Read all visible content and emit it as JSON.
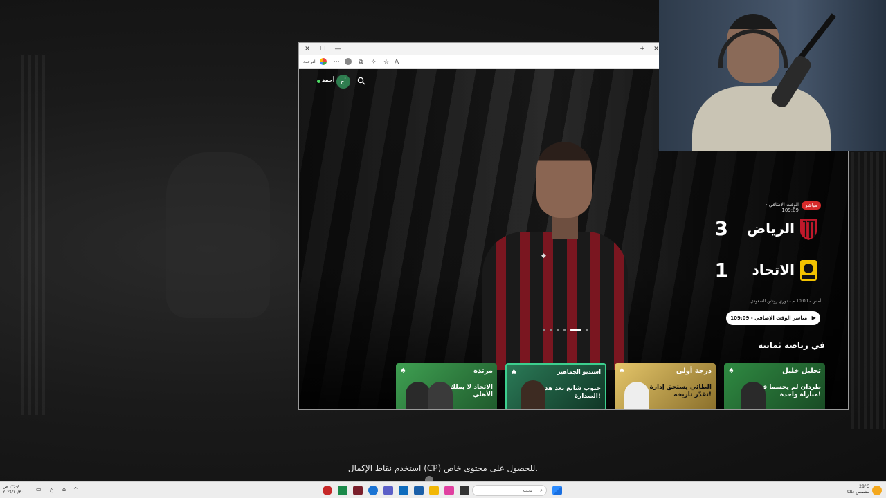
{
  "subtitle": "استخدم نقاط الإكمال (CP) للحصول على محتوى خاص.",
  "browser": {
    "titlebar": {
      "close": "✕",
      "maximize": "☐",
      "minimize": "—",
      "new_tab": "+"
    },
    "toolbar": {
      "label": "الترجمة",
      "more": "⋯",
      "read_aloud": "A"
    }
  },
  "site": {
    "user_name": "أحمد",
    "avatar_initials": "أح",
    "icons": {
      "search": "search-icon",
      "avatar": "avatar-icon"
    }
  },
  "match": {
    "live_label": "مباشر",
    "extra_time_label": "الوقت الإضافي - 109:09",
    "home_team": {
      "name": "الرياض",
      "score": "3",
      "color": "#c0182a"
    },
    "away_team": {
      "name": "الاتحاد",
      "score": "1",
      "color": "#f2c200"
    },
    "info": "أمس - 10:00 م - دوري روشن السعودي",
    "watch_button": "مباشر الوقت الإضافي - 109:09",
    "carousel_dots": 6,
    "active_dot": 5
  },
  "section": {
    "title": "في رياضة ثمانية",
    "cards": [
      {
        "label": "تحليل خليل",
        "caption": "طردان لم يحسما في مباراة واحدة!",
        "color": "#2a7a3b"
      },
      {
        "label": "درجة أولى",
        "caption": "الطائي يستحق إدارة تقدّر تاريخه!",
        "color": "#c9a23a"
      },
      {
        "label": "استديو الجماهير",
        "caption": "جنوب شابع بعد هدف الصدارة!",
        "color": "#1f6b4a"
      },
      {
        "label": "مرتدة",
        "caption": "الاتحاد لا يملك صبر الأهلي",
        "color": "#2f8a42"
      }
    ]
  },
  "taskbar": {
    "search_placeholder": "بحث",
    "clock_time": "١٢:٠٨ ص",
    "clock_date": "٢٠٢٤/١٠/٣٠",
    "lang": "ع",
    "weather_temp": "28°C",
    "weather_desc": "مشمس غالبًا"
  }
}
